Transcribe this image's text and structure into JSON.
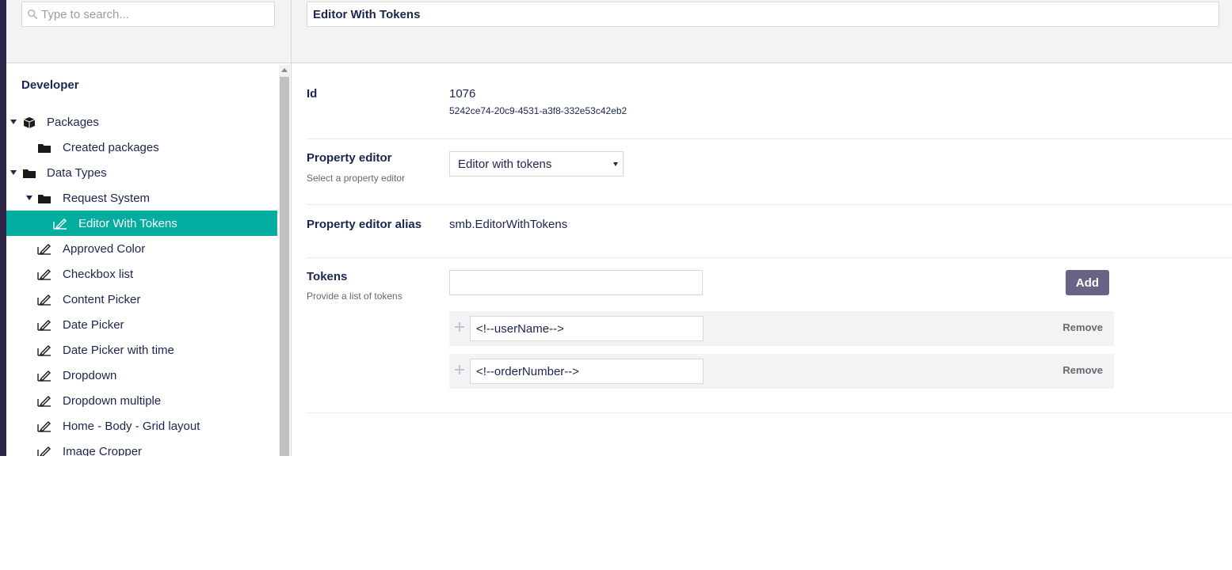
{
  "search": {
    "placeholder": "Type to search..."
  },
  "tree": {
    "title": "Developer",
    "items": [
      {
        "label": "Packages",
        "icon": "package-icon"
      },
      {
        "label": "Created packages",
        "icon": "folder-icon"
      },
      {
        "label": "Data Types",
        "icon": "folder-icon"
      },
      {
        "label": "Request System",
        "icon": "folder-icon"
      },
      {
        "label": "Editor With Tokens",
        "icon": "datatype-icon",
        "active": true
      },
      {
        "label": "Approved Color",
        "icon": "datatype-icon"
      },
      {
        "label": "Checkbox list",
        "icon": "datatype-icon"
      },
      {
        "label": "Content Picker",
        "icon": "datatype-icon"
      },
      {
        "label": "Date Picker",
        "icon": "datatype-icon"
      },
      {
        "label": "Date Picker with time",
        "icon": "datatype-icon"
      },
      {
        "label": "Dropdown",
        "icon": "datatype-icon"
      },
      {
        "label": "Dropdown multiple",
        "icon": "datatype-icon"
      },
      {
        "label": "Home - Body - Grid layout",
        "icon": "datatype-icon"
      },
      {
        "label": "Image Cropper",
        "icon": "datatype-icon"
      }
    ]
  },
  "editor": {
    "name": "Editor With Tokens",
    "id": {
      "label": "Id",
      "value": "1076",
      "guid": "5242ce74-20c9-4531-a3f8-332e53c42eb2"
    },
    "property_editor": {
      "label": "Property editor",
      "description": "Select a property editor",
      "selected": "Editor with tokens"
    },
    "alias": {
      "label": "Property editor alias",
      "value": "smb.EditorWithTokens"
    },
    "tokens": {
      "label": "Tokens",
      "description": "Provide a list of tokens",
      "add_label": "Add",
      "remove_label": "Remove",
      "items": [
        "<!--userName-->",
        "<!--orderNumber-->"
      ]
    }
  },
  "colors": {
    "accent": "#03aea0",
    "button": "#6b6385",
    "text": "#1b264f",
    "sidebar_strip": "#2e2447"
  }
}
